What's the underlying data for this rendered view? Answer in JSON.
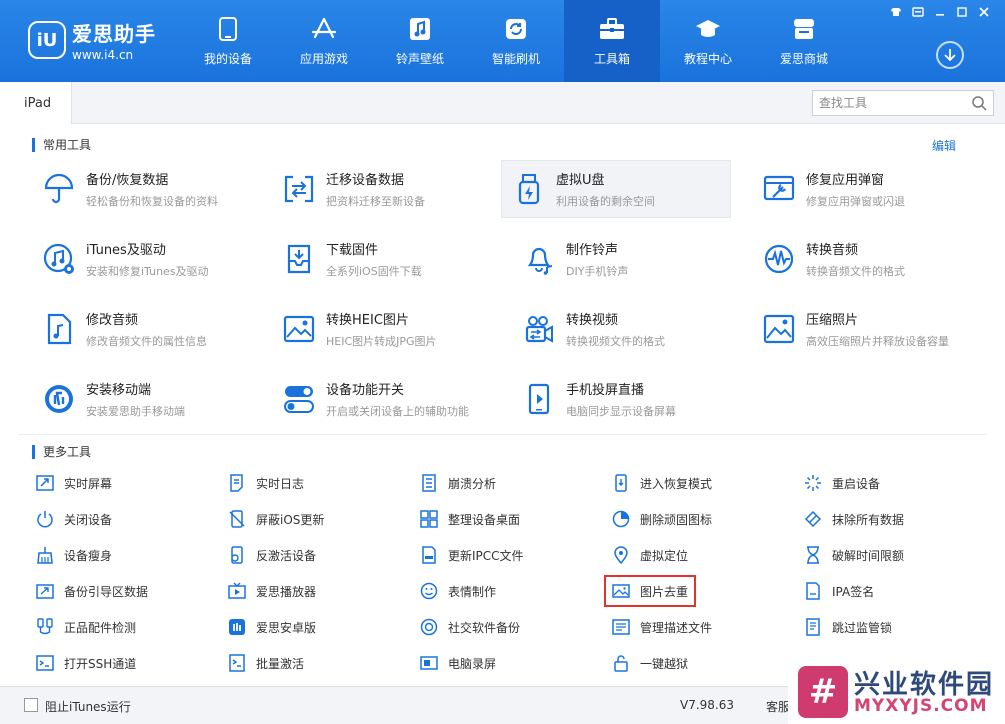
{
  "app": {
    "logo_badge": "iU",
    "logo_title": "爱思助手",
    "logo_url": "www.i4.cn"
  },
  "nav": [
    {
      "label": "我的设备",
      "icon": "phone-icon"
    },
    {
      "label": "应用游戏",
      "icon": "app-store-icon"
    },
    {
      "label": "铃声壁纸",
      "icon": "music-note-icon"
    },
    {
      "label": "智能刷机",
      "icon": "refresh-icon"
    },
    {
      "label": "工具箱",
      "icon": "toolbox-icon"
    },
    {
      "label": "教程中心",
      "icon": "graduation-cap-icon"
    },
    {
      "label": "爱思商城",
      "icon": "shop-icon"
    }
  ],
  "tab": {
    "device": "iPad"
  },
  "search": {
    "placeholder": "查找工具"
  },
  "common": {
    "title": "常用工具",
    "edit": "编辑",
    "tools": [
      {
        "title": "备份/恢复数据",
        "sub": "轻松备份和恢复设备的资料",
        "icon": "umbrella-icon"
      },
      {
        "title": "迁移设备数据",
        "sub": "把资料迁移至新设备",
        "icon": "transfer-icon"
      },
      {
        "title": "虚拟U盘",
        "sub": "利用设备的剩余空间",
        "icon": "usb-drive-icon"
      },
      {
        "title": "修复应用弹窗",
        "sub": "修复应用弹窗或闪退",
        "icon": "repair-window-icon"
      },
      {
        "title": "iTunes及驱动",
        "sub": "安装和修复iTunes及驱动",
        "icon": "itunes-icon"
      },
      {
        "title": "下载固件",
        "sub": "全系列iOS固件下载",
        "icon": "download-firmware-icon"
      },
      {
        "title": "制作铃声",
        "sub": "DIY手机铃声",
        "icon": "bell-icon"
      },
      {
        "title": "转换音频",
        "sub": "转换音频文件的格式",
        "icon": "audio-wave-icon"
      },
      {
        "title": "修改音频",
        "sub": "修改音频文件的属性信息",
        "icon": "audio-file-icon"
      },
      {
        "title": "转换HEIC图片",
        "sub": "HEIC图片转成JPG图片",
        "icon": "heic-image-icon"
      },
      {
        "title": "转换视频",
        "sub": "转换视频文件的格式",
        "icon": "video-convert-icon"
      },
      {
        "title": "压缩照片",
        "sub": "高效压缩照片并释放设备容量",
        "icon": "photo-compress-icon"
      },
      {
        "title": "安装移动端",
        "sub": "安装爱思助手移动端",
        "icon": "install-mobile-icon"
      },
      {
        "title": "设备功能开关",
        "sub": "开启或关闭设备上的辅助功能",
        "icon": "toggle-switch-icon"
      },
      {
        "title": "手机投屏直播",
        "sub": "电脑同步显示设备屏幕",
        "icon": "screen-mirror-icon"
      }
    ]
  },
  "more": {
    "title": "更多工具",
    "tools": [
      {
        "label": "实时屏幕",
        "icon": "live-screen-icon"
      },
      {
        "label": "实时日志",
        "icon": "log-icon"
      },
      {
        "label": "崩溃分析",
        "icon": "crash-analysis-icon"
      },
      {
        "label": "进入恢复模式",
        "icon": "recovery-mode-icon"
      },
      {
        "label": "重启设备",
        "icon": "restart-icon"
      },
      {
        "label": "关闭设备",
        "icon": "power-icon"
      },
      {
        "label": "屏蔽iOS更新",
        "icon": "block-update-icon"
      },
      {
        "label": "整理设备桌面",
        "icon": "grid-icon"
      },
      {
        "label": "删除顽固图标",
        "icon": "delete-icon-icon"
      },
      {
        "label": "抹除所有数据",
        "icon": "eraser-icon"
      },
      {
        "label": "设备瘦身",
        "icon": "broom-icon"
      },
      {
        "label": "反激活设备",
        "icon": "deactivate-icon"
      },
      {
        "label": "更新IPCC文件",
        "icon": "ipcc-file-icon"
      },
      {
        "label": "虚拟定位",
        "icon": "location-pin-icon"
      },
      {
        "label": "破解时间限额",
        "icon": "hourglass-icon"
      },
      {
        "label": "备份引导区数据",
        "icon": "boot-backup-icon"
      },
      {
        "label": "爱思播放器",
        "icon": "tv-player-icon"
      },
      {
        "label": "表情制作",
        "icon": "smiley-icon"
      },
      {
        "label": "图片去重",
        "icon": "image-dedupe-icon"
      },
      {
        "label": "IPA签名",
        "icon": "ipa-sign-icon"
      },
      {
        "label": "正品配件检测",
        "icon": "accessory-check-icon"
      },
      {
        "label": "爱思安卓版",
        "icon": "android-app-icon"
      },
      {
        "label": "社交软件备份",
        "icon": "social-backup-icon"
      },
      {
        "label": "管理描述文件",
        "icon": "profile-manage-icon"
      },
      {
        "label": "跳过监管锁",
        "icon": "supervision-lock-icon"
      },
      {
        "label": "打开SSH通道",
        "icon": "terminal-icon"
      },
      {
        "label": "批量激活",
        "icon": "batch-activate-icon"
      },
      {
        "label": "电脑录屏",
        "icon": "screen-record-icon"
      },
      {
        "label": "一键越狱",
        "icon": "jailbreak-lock-icon"
      }
    ]
  },
  "status": {
    "block_itunes": "阻止iTunes运行",
    "version": "V7.98.63",
    "service": "客服"
  },
  "watermark": {
    "title": "兴业软件园",
    "url": "MYXYJS.COM"
  },
  "colors": {
    "brand": "#1a73dc",
    "highlight_box": "#e0352b"
  }
}
